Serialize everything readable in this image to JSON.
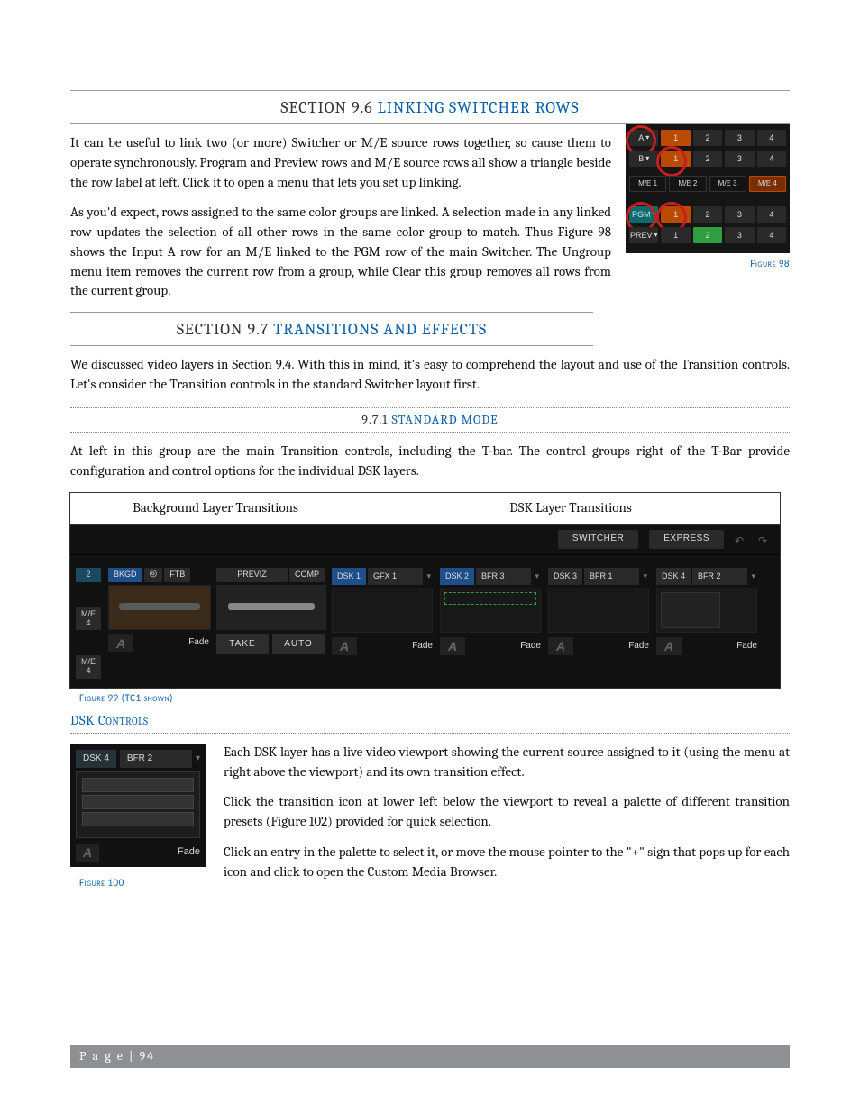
{
  "sections": {
    "s96": {
      "num": "SECTION 9.6",
      "name": "LINKING SWITCHER ROWS"
    },
    "s97": {
      "num": "SECTION 9.7",
      "name": "TRANSITIONS AND EFFECTS"
    },
    "s971": {
      "num": "9.7.1",
      "name": "STANDARD MODE"
    }
  },
  "paras": {
    "p1": "It can be useful to link two (or more) Switcher or M/E source rows together, so cause them to operate synchronously.   Program and Preview rows and M/E source rows all show a triangle beside the row label at left. Click it to open a menu that lets you set up linking.",
    "p2": "As you'd expect, rows assigned to the same color groups are linked. A selection made in any linked row updates the selection of all other rows in the same color group to match. Thus Figure 98 shows the Input A row for an M/E linked to the PGM row of the main Switcher.  The Ungroup menu item removes the current row from a group, while Clear this group removes all rows from the current group.",
    "p3": "We discussed video layers in Section 9.4.  With this in mind, it's easy to comprehend the layout and use of the Transition controls.  Let's consider the Transition controls in the standard Switcher layout first.",
    "p4": "At left in this group are the main Transition controls, including the T-bar.  The control groups right of the T-Bar provide configuration and control options for the individual DSK layers.",
    "p5": "Each DSK layer has a live video viewport showing the current source assigned to it (using the menu at right above the viewport) and its own transition effect.",
    "p6": "Click the transition icon at lower left below the viewport to reveal a palette of different transition presets (Figure 102) provided for quick selection.",
    "p7": "Click an entry in the palette to select it, or move the mouse pointer to the \"+\" sign that pops up for each icon and click to open the Custom Media Browser."
  },
  "dsk_header": "DSK Controls",
  "figcaps": {
    "f98": "Figure 98",
    "f99": "Figure 99 (TC1 shown)",
    "f100": "Figure 100"
  },
  "fig98": {
    "rowA": {
      "label": "A",
      "cells": [
        "1",
        "2",
        "3",
        "4"
      ]
    },
    "rowB": {
      "label": "B",
      "cells": [
        "1",
        "2",
        "3",
        "4"
      ]
    },
    "rowME": {
      "cells": [
        "M/E 1",
        "M/E 2",
        "M/E 3",
        "M/E 4"
      ]
    },
    "rowPGM": {
      "label": "PGM",
      "cells": [
        "1",
        "2",
        "3",
        "4"
      ]
    },
    "rowPREV": {
      "label": "PREV",
      "cells": [
        "1",
        "2",
        "3",
        "4"
      ]
    }
  },
  "fig99": {
    "hd_left": "Background Layer Transitions",
    "hd_right": "DSK Layer Transitions",
    "tabs": {
      "switcher": "SWITCHER",
      "express": "EXPRESS"
    },
    "leftslots": {
      "two": "2",
      "me4a": "M/E\n4",
      "me4b": "M/E\n4"
    },
    "g1": {
      "bkgd": "BKGD",
      "ftb": "FTB",
      "fade": "Fade",
      "a": "A"
    },
    "g2": {
      "previz": "PREVIZ",
      "comp": "COMP",
      "take": "TAKE",
      "auto": "AUTO"
    },
    "dsks": [
      {
        "a": "DSK 1",
        "b": "GFX 1",
        "fade": "Fade",
        "t": "A",
        "aclass": "blue"
      },
      {
        "a": "DSK 2",
        "b": "BFR 3",
        "fade": "Fade",
        "t": "A",
        "aclass": "blue"
      },
      {
        "a": "DSK 3",
        "b": "BFR 1",
        "fade": "Fade",
        "t": "A",
        "aclass": "dark"
      },
      {
        "a": "DSK 4",
        "b": "BFR 2",
        "fade": "Fade",
        "t": "A",
        "aclass": "dark"
      }
    ]
  },
  "fig100": {
    "a": "DSK 4",
    "b": "BFR 2",
    "fade": "Fade",
    "t": "A"
  },
  "footer": "P a g e  |  94"
}
